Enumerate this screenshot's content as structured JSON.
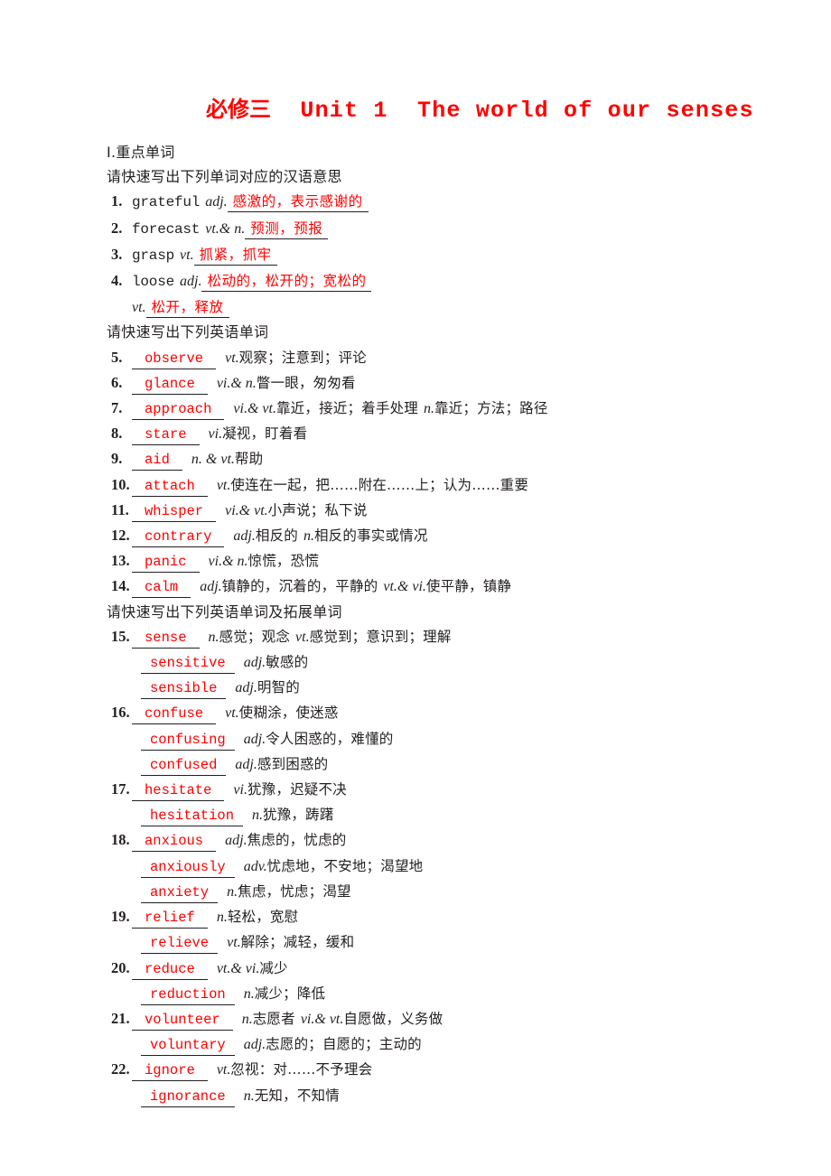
{
  "title": {
    "cn_prefix": "必修三",
    "en": "Unit 1  The world of our senses",
    "color": "#ff0000"
  },
  "section_label": "Ⅰ.重点单词",
  "instructions": {
    "cn_meaning": "请快速写出下列单词对应的汉语意思",
    "en_word": "请快速写出下列英语单词",
    "en_word_extended": "请快速写出下列英语单词及拓展单词"
  },
  "group_a": [
    {
      "num": "1.",
      "word": "grateful",
      "pos": "adj.",
      "answer": "感激的，表示感谢的"
    },
    {
      "num": "2.",
      "word": "forecast",
      "pos": "vt.& n.",
      "answer": "预测，预报"
    },
    {
      "num": "3.",
      "word": "grasp",
      "pos": "vt.",
      "answer": "抓紧，抓牢"
    },
    {
      "num": "4.",
      "word": "loose",
      "pos": "adj.",
      "answer": "松动的，松开的；宽松的"
    },
    {
      "num": "",
      "word": "",
      "pos": "vt.",
      "answer": "松开，释放"
    }
  ],
  "group_b": [
    {
      "num": "5.",
      "answer": "observe",
      "pos": "vt.",
      "gloss": "观察；注意到；评论"
    },
    {
      "num": "6.",
      "answer": "glance",
      "pos": "vi.& n.",
      "gloss": "瞥一眼，匆匆看"
    },
    {
      "num": "7.",
      "answer": "approach",
      "pos": "vi.& vt.",
      "gloss": "靠近，接近；着手处理",
      "pos2": "n.",
      "gloss2": "靠近；方法；路径"
    },
    {
      "num": "8.",
      "answer": "stare",
      "pos": "vi.",
      "gloss": "凝视，盯着看"
    },
    {
      "num": "9.",
      "answer": "aid",
      "pos": "n. & vt.",
      "gloss": "帮助"
    },
    {
      "num": "10.",
      "answer": "attach",
      "pos": "vt.",
      "gloss": "使连在一起，把……附在……上；认为……重要"
    },
    {
      "num": "11.",
      "answer": "whisper",
      "pos": "vi.& vt.",
      "gloss": "小声说；私下说"
    },
    {
      "num": "12.",
      "answer": "contrary",
      "pos": "adj.",
      "gloss": "相反的",
      "pos2": "n.",
      "gloss2": "相反的事实或情况"
    },
    {
      "num": "13.",
      "answer": "panic",
      "pos": "vi.& n.",
      "gloss": "惊慌，恐慌"
    },
    {
      "num": "14.",
      "answer": "calm",
      "pos": "adj.",
      "gloss": "镇静的，沉着的，平静的",
      "pos2": "vt.& vi.",
      "gloss2": "使平静，镇静"
    }
  ],
  "group_c": [
    {
      "num": "15.",
      "answer": "sense",
      "pos": "n.",
      "gloss": "感觉；观念",
      "pos2": "vt.",
      "gloss2": "感觉到；意识到；理解"
    },
    {
      "num": "",
      "answer": "sensitive",
      "pos": "adj.",
      "gloss": "敏感的"
    },
    {
      "num": "",
      "answer": "sensible",
      "pos": "adj.",
      "gloss": "明智的"
    },
    {
      "num": "16.",
      "answer": "confuse",
      "pos": "vt.",
      "gloss": "使糊涂，使迷惑"
    },
    {
      "num": "",
      "answer": "confusing",
      "pos": "adj.",
      "gloss": "令人困惑的，难懂的"
    },
    {
      "num": "",
      "answer": "confused",
      "pos": "adj.",
      "gloss": "感到困惑的"
    },
    {
      "num": "17.",
      "answer": "hesitate",
      "pos": "vi.",
      "gloss": "犹豫，迟疑不决"
    },
    {
      "num": "",
      "answer": "hesitation",
      "pos": "n.",
      "gloss": "犹豫，踌躇"
    },
    {
      "num": "18.",
      "answer": "anxious",
      "pos": "adj.",
      "gloss": "焦虑的，忧虑的"
    },
    {
      "num": "",
      "answer": "anxiously",
      "pos": "adv.",
      "gloss": "忧虑地，不安地；渴望地"
    },
    {
      "num": "",
      "answer": "anxiety",
      "pos": "n.",
      "gloss": "焦虑，忧虑；渴望"
    },
    {
      "num": "19.",
      "answer": "relief",
      "pos": "n.",
      "gloss": "轻松，宽慰"
    },
    {
      "num": "",
      "answer": "relieve",
      "pos": "vt.",
      "gloss": "解除；减轻，缓和"
    },
    {
      "num": "20.",
      "answer": "reduce",
      "pos": "vt.& vi.",
      "gloss": "减少"
    },
    {
      "num": "",
      "answer": "reduction",
      "pos": "n.",
      "gloss": "减少；降低"
    },
    {
      "num": "21.",
      "answer": "volunteer",
      "pos": "n.",
      "gloss": "志愿者",
      "pos2": "vi.& vt.",
      "gloss2": "自愿做，义务做"
    },
    {
      "num": "",
      "answer": "voluntary",
      "pos": "adj.",
      "gloss": "志愿的；自愿的；主动的"
    },
    {
      "num": "22.",
      "answer": "ignore",
      "pos": "vt.",
      "gloss": "忽视：对……不予理会"
    },
    {
      "num": "",
      "answer": "ignorance",
      "pos": "n.",
      "gloss": "无知，不知情"
    }
  ]
}
